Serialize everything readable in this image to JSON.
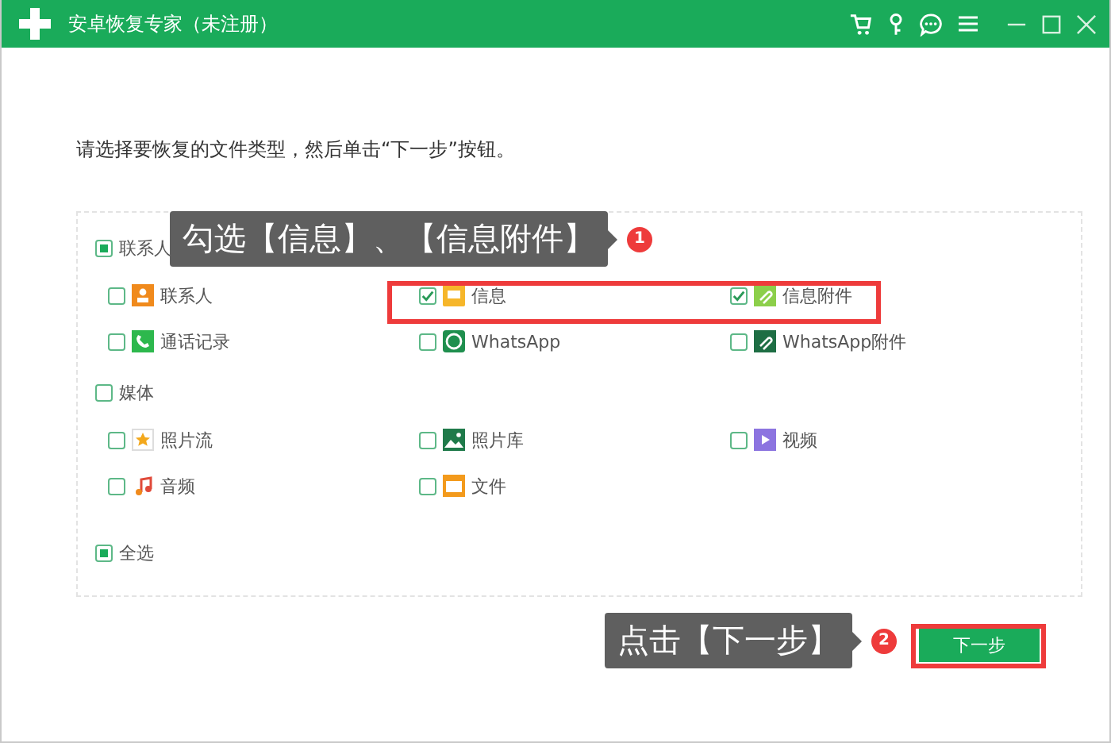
{
  "window": {
    "title": "安卓恢复专家（未注册）"
  },
  "instruction": "请选择要恢复的文件类型，然后单击“下一步”按钮。",
  "groups": [
    {
      "label": "联系人",
      "indeterminate": true,
      "items": [
        {
          "label": "联系人",
          "checked": false
        },
        {
          "label": "信息",
          "checked": true
        },
        {
          "label": "信息附件",
          "checked": true
        },
        {
          "label": "通话记录",
          "checked": false
        },
        {
          "label": "WhatsApp",
          "checked": false
        },
        {
          "label": "WhatsApp附件",
          "checked": false
        }
      ]
    },
    {
      "label": "媒体",
      "indeterminate": false,
      "items": [
        {
          "label": "照片流",
          "checked": false
        },
        {
          "label": "照片库",
          "checked": false
        },
        {
          "label": "视频",
          "checked": false
        },
        {
          "label": "音频",
          "checked": false
        },
        {
          "label": "文件",
          "checked": false
        }
      ]
    }
  ],
  "select_all": {
    "label": "全选",
    "indeterminate": true
  },
  "next_button": "下一步",
  "annotations": [
    {
      "text": "勾选【信息】、【信息附件】",
      "number": "1"
    },
    {
      "text": "点击【下一步】",
      "number": "2"
    }
  ]
}
